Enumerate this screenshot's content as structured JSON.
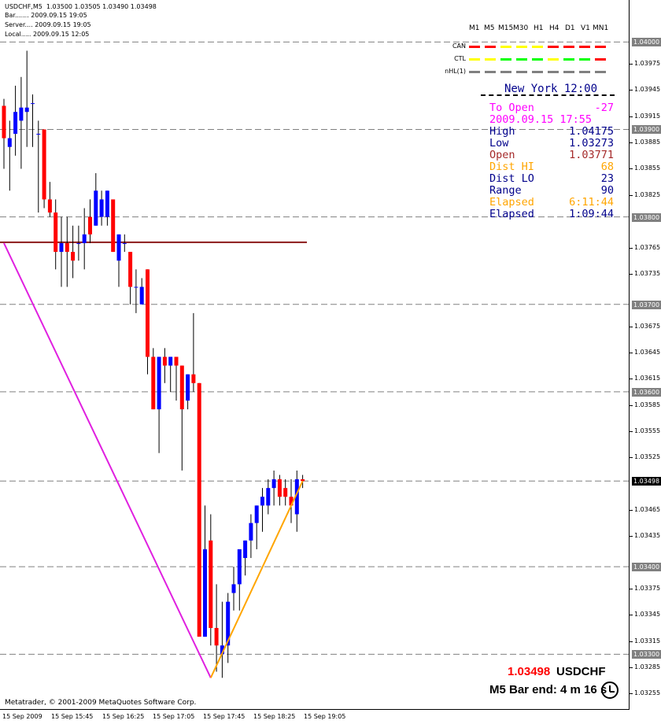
{
  "header": {
    "line1": "USDCHF,M5  1.03500 1.03505 1.03490 1.03498",
    "line2": "Bar....... 2009.09.15 19:05",
    "line3": "Server.... 2009.09.15 19:05",
    "line4": "Local..... 2009.09.15 12:05"
  },
  "timeframes": [
    "M1",
    "M5",
    "M15",
    "M30",
    "H1",
    "H4",
    "D1",
    "V1",
    "MN1"
  ],
  "indicators": [
    {
      "label": "CAN",
      "colors": [
        "#ff0000",
        "#ff0000",
        "#ffff00",
        "#ffff00",
        "#ffff00",
        "#ff0000",
        "#ff0000",
        "#ff0000",
        "#ff0000"
      ]
    },
    {
      "label": "CTL",
      "colors": [
        "#ffff00",
        "#ffff00",
        "#00ff00",
        "#00ff00",
        "#00ff00",
        "#ffff00",
        "#00ff00",
        "#00ff00",
        "#ff0000"
      ]
    },
    {
      "label": "nHL(1)",
      "colors": [
        "#808080",
        "#808080",
        "#808080",
        "#808080",
        "#808080",
        "#808080",
        "#808080",
        "#808080",
        "#808080"
      ]
    }
  ],
  "info": {
    "title": "New York 12:00",
    "rows": [
      {
        "k": "To Open",
        "v": "-27",
        "color": "#ff00ff"
      },
      {
        "k": "2009.09.15 17:55",
        "v": "",
        "color": "#ff00ff"
      },
      {
        "k": "High",
        "v": "1.04175",
        "color": "#00008b"
      },
      {
        "k": "Low",
        "v": "1.03273",
        "color": "#00008b"
      },
      {
        "k": "Open",
        "v": "1.03771",
        "color": "#a52a2a"
      },
      {
        "k": "Dist HI",
        "v": "68",
        "color": "#ffa500"
      },
      {
        "k": "Dist LO",
        "v": "23",
        "color": "#00008b"
      },
      {
        "k": "Range",
        "v": "90",
        "color": "#00008b"
      },
      {
        "k": "Elapsed",
        "v": "6:11:44",
        "color": "#ffa500"
      },
      {
        "k": "Elapsed",
        "v": "1:09:44",
        "color": "#00008b"
      }
    ]
  },
  "current_price": "1.03498",
  "symbol": "USDCHF",
  "bar_end": "M5 Bar end: 4 m 16 s",
  "copyright": "Metatrader, © 2001-2009 MetaQuotes Software Corp.",
  "y_axis": {
    "labels": [
      "1.03975",
      "1.03945",
      "1.03915",
      "1.03885",
      "1.03855",
      "1.03825",
      "1.03765",
      "1.03735",
      "1.03675",
      "1.03645",
      "1.03615",
      "1.03585",
      "1.03555",
      "1.03525",
      "1.03465",
      "1.03435",
      "1.03375",
      "1.03345",
      "1.03315",
      "1.03285",
      "1.03255"
    ],
    "highlighted": [
      "1.04000",
      "1.03900",
      "1.03800",
      "1.03700",
      "1.03600",
      "1.03400",
      "1.03300"
    ]
  },
  "x_axis": [
    "15 Sep 2009",
    "15 Sep 15:45",
    "15 Sep 16:25",
    "15 Sep 17:05",
    "15 Sep 17:45",
    "15 Sep 18:25",
    "15 Sep 19:05"
  ],
  "chart_data": {
    "type": "candlestick",
    "ylim": [
      1.0324,
      1.0403
    ],
    "levels": [
      1.04,
      1.039,
      1.038,
      1.037,
      1.036,
      1.03498,
      1.034,
      1.033
    ],
    "open_line": 1.03771,
    "bull_color": "#0000ff",
    "bear_color": "#ff0000",
    "candles": [
      [
        1.03927,
        1.03935,
        1.03855,
        1.0389
      ],
      [
        1.0388,
        1.0391,
        1.0383,
        1.0389
      ],
      [
        1.03895,
        1.0395,
        1.0387,
        1.0392
      ],
      [
        1.0391,
        1.0396,
        1.03855,
        1.03925
      ],
      [
        1.0392,
        1.0399,
        1.0388,
        1.03925
      ],
      [
        1.0393,
        1.0394,
        1.0388,
        1.0393
      ],
      [
        1.03895,
        1.0391,
        1.03805,
        1.03895
      ],
      [
        1.039,
        1.039,
        1.0381,
        1.0382
      ],
      [
        1.0382,
        1.0384,
        1.038,
        1.03805
      ],
      [
        1.03805,
        1.0382,
        1.0374,
        1.0376
      ],
      [
        1.0376,
        1.038,
        1.0372,
        1.0377
      ],
      [
        1.0377,
        1.038,
        1.0372,
        1.0376
      ],
      [
        1.0376,
        1.0379,
        1.0373,
        1.0375
      ],
      [
        1.0377,
        1.0379,
        1.0375,
        1.0377
      ],
      [
        1.0377,
        1.0381,
        1.0374,
        1.0378
      ],
      [
        1.038,
        1.0382,
        1.0377,
        1.0378
      ],
      [
        1.0379,
        1.0385,
        1.0379,
        1.0383
      ],
      [
        1.038,
        1.0383,
        1.0379,
        1.0382
      ],
      [
        1.038,
        1.0383,
        1.0379,
        1.0383
      ],
      [
        1.0382,
        1.0381,
        1.0376,
        1.0376
      ],
      [
        1.0375,
        1.0378,
        1.0372,
        1.0378
      ],
      [
        1.0377,
        1.0378,
        1.0376,
        1.0377
      ],
      [
        1.0376,
        1.0376,
        1.037,
        1.0372
      ],
      [
        1.0372,
        1.0374,
        1.0369,
        1.0372
      ],
      [
        1.037,
        1.0373,
        1.0371,
        1.0372
      ],
      [
        1.0374,
        1.0374,
        1.0362,
        1.0364
      ],
      [
        1.0364,
        1.0365,
        1.0358,
        1.0358
      ],
      [
        1.0358,
        1.0364,
        1.0353,
        1.0364
      ],
      [
        1.0364,
        1.0365,
        1.0361,
        1.0363
      ],
      [
        1.0363,
        1.0364,
        1.036,
        1.0364
      ],
      [
        1.0364,
        1.0364,
        1.0359,
        1.0363
      ],
      [
        1.0363,
        1.0363,
        1.0351,
        1.0358
      ],
      [
        1.0359,
        1.0362,
        1.0358,
        1.0362
      ],
      [
        1.0362,
        1.0369,
        1.036,
        1.0361
      ],
      [
        1.0361,
        1.0361,
        1.0345,
        1.0332
      ],
      [
        1.0332,
        1.0347,
        1.0332,
        1.0342
      ],
      [
        1.0343,
        1.0346,
        1.0331,
        1.0333
      ],
      [
        1.0333,
        1.0338,
        1.0328,
        1.0331
      ],
      [
        1.033,
        1.0336,
        1.03273,
        1.0331
      ],
      [
        1.0331,
        1.0337,
        1.0329,
        1.0336
      ],
      [
        1.0337,
        1.034,
        1.0335,
        1.0338
      ],
      [
        1.0338,
        1.0342,
        1.0335,
        1.0342
      ],
      [
        1.0341,
        1.0343,
        1.0339,
        1.0343
      ],
      [
        1.0343,
        1.0346,
        1.0341,
        1.0345
      ],
      [
        1.0345,
        1.0347,
        1.0342,
        1.0347
      ],
      [
        1.0347,
        1.0349,
        1.0344,
        1.0348
      ],
      [
        1.0347,
        1.035,
        1.0346,
        1.0349
      ],
      [
        1.0349,
        1.0351,
        1.0347,
        1.035
      ],
      [
        1.035,
        1.03505,
        1.0347,
        1.0348
      ],
      [
        1.0349,
        1.035,
        1.0347,
        1.0348
      ],
      [
        1.0348,
        1.035,
        1.0345,
        1.0347
      ],
      [
        1.0346,
        1.0351,
        1.0344,
        1.035
      ],
      [
        1.035,
        1.03505,
        1.0349,
        1.03498
      ]
    ],
    "zigzag": [
      [
        0,
        1.0377
      ],
      [
        36,
        1.03273
      ]
    ],
    "trendline": [
      [
        36,
        1.03273
      ],
      [
        52,
        1.03498
      ]
    ]
  }
}
